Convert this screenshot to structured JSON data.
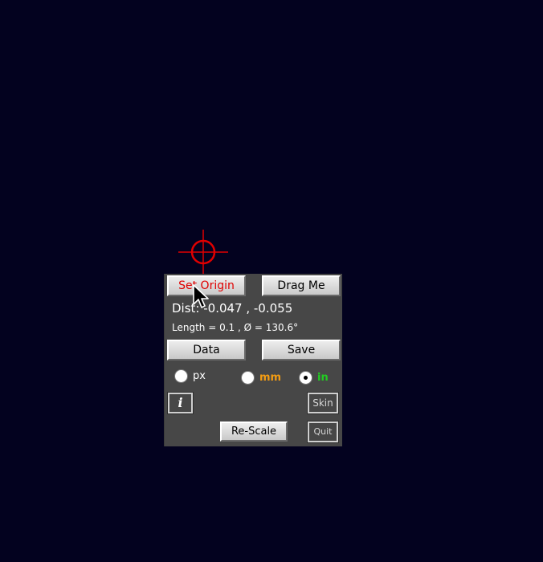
{
  "buttons": {
    "set_origin": "Set Origin",
    "drag_me": "Drag Me",
    "data": "Data",
    "save": "Save",
    "rescale": "Re-Scale",
    "info": "i",
    "skin": "Skin",
    "quit": "Quit"
  },
  "readout": {
    "dist": "Dist: -0.047 , -0.055",
    "length": "Length = 0.1 ,  Ø = 130.6°"
  },
  "units": {
    "options": [
      {
        "label": "px",
        "selected": false,
        "color": "#ffffff"
      },
      {
        "label": "mm",
        "selected": false,
        "color": "#f39c12"
      },
      {
        "label": "in",
        "selected": true,
        "color": "#22cc22"
      }
    ]
  },
  "colors": {
    "background": "#03021f",
    "panel": "#474747",
    "crosshair": "#e00000",
    "origin_label": "#e00000"
  },
  "icons": {
    "crosshair": "crosshair-target-icon",
    "pointer": "mouse-pointer-icon"
  }
}
